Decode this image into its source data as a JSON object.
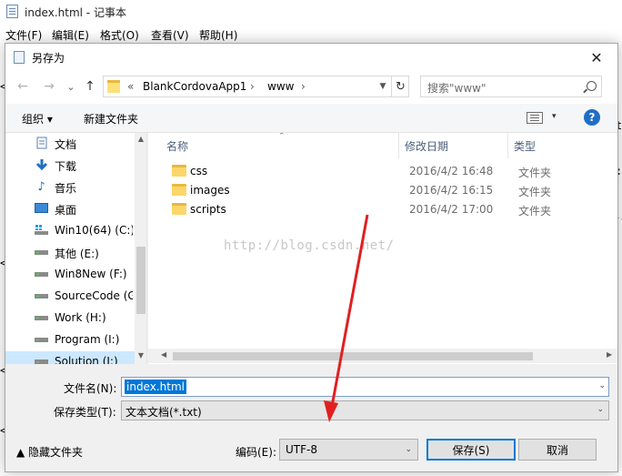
{
  "notepad": {
    "title": "index.html - 记事本",
    "menus": [
      "文件(F)",
      "编辑(E)",
      "格式(O)",
      "查看(V)",
      "帮助(H)"
    ],
    "peek_right": [
      ":",
      "t-",
      ":",
      "1,"
    ],
    "peek_left": [
      "<",
      "<",
      "<",
      "<",
      "<",
      "<",
      "<",
      "<",
      "<",
      "<",
      "<",
      "<"
    ]
  },
  "dialog": {
    "title": "另存为",
    "close_glyph": "✕",
    "nav": {
      "back": "←",
      "forward": "→",
      "dropdown": "⌄",
      "up": "↑",
      "breadcrumb_prefix": "«",
      "breadcrumbs": [
        "BlankCordovaApp1",
        "www"
      ],
      "breadcrumb_sep": "›",
      "address_dropdown": "▼",
      "refresh": "↻",
      "search_placeholder": "搜索\"www\""
    },
    "toolbar": {
      "organize": "组织 ▾",
      "new_folder": "新建文件夹",
      "view_dropdown": "▾",
      "help": "?"
    },
    "nav_pane": [
      {
        "label": "文档",
        "icon": "document-icon"
      },
      {
        "label": "下载",
        "icon": "download-icon"
      },
      {
        "label": "音乐",
        "icon": "music-icon"
      },
      {
        "label": "桌面",
        "icon": "desktop-icon"
      },
      {
        "label": "Win10(64) (C:)",
        "icon": "windows-drive-icon"
      },
      {
        "label": "其他 (E:)",
        "icon": "drive-icon"
      },
      {
        "label": "Win8New (F:)",
        "icon": "drive-icon"
      },
      {
        "label": "SourceCode (G",
        "icon": "drive-icon"
      },
      {
        "label": "Work (H:)",
        "icon": "drive-icon"
      },
      {
        "label": "Program (I:)",
        "icon": "drive-icon"
      },
      {
        "label": "Solution (J:)",
        "icon": "drive-icon"
      }
    ],
    "columns": {
      "name": "名称",
      "date": "修改日期",
      "type": "类型"
    },
    "files": [
      {
        "name": "css",
        "date": "2016/4/2 16:48",
        "type": "文件夹"
      },
      {
        "name": "images",
        "date": "2016/4/2 16:15",
        "type": "文件夹"
      },
      {
        "name": "scripts",
        "date": "2016/4/2 17:00",
        "type": "文件夹"
      }
    ],
    "watermark": "http://blog.csdn.net/",
    "filename_label": "文件名(N):",
    "filename_value": "index.html",
    "filetype_label": "保存类型(T):",
    "filetype_value": "文本文档(*.txt)",
    "hide_folders": "▲ 隐藏文件夹",
    "encoding_label": "编码(E):",
    "encoding_value": "UTF-8",
    "save_button": "保存(S)",
    "cancel_button": "取消"
  },
  "colors": {
    "accent": "#0078d7",
    "selection": "#cce8ff",
    "annotation_arrow": "#e02020"
  }
}
